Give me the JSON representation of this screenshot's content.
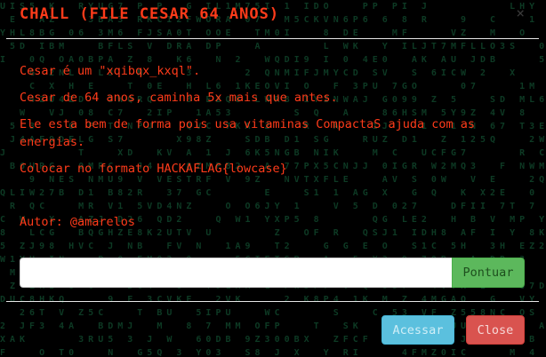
{
  "modal": {
    "title": "CHALL (FILE CESAR 64 ANOS)",
    "close_icon": "×",
    "lines": [
      "Cesar é um \"xqibqx_kxql\".",
      "Cesar de 64 anos, caminha 5x mais que antes.",
      "Ele esta bem de forma pois usa vitaminas CompactaS ajuda com as energias.",
      "Colocar no formato HACKAFLAG{lowcase}",
      "Autor: @amarelos"
    ],
    "flag_input": {
      "value": "",
      "placeholder": ""
    },
    "submit_label": "Pontuar",
    "access_label": "Acessar",
    "close_label": "Close"
  },
  "colors": {
    "title": "#ff3b1a",
    "text": "#ff3b1a",
    "matrix": "#0d3a24",
    "submit": "#5cb85c",
    "access": "#5bc0de",
    "close": "#d9534f"
  },
  "icons": {
    "close": "close-icon"
  }
}
